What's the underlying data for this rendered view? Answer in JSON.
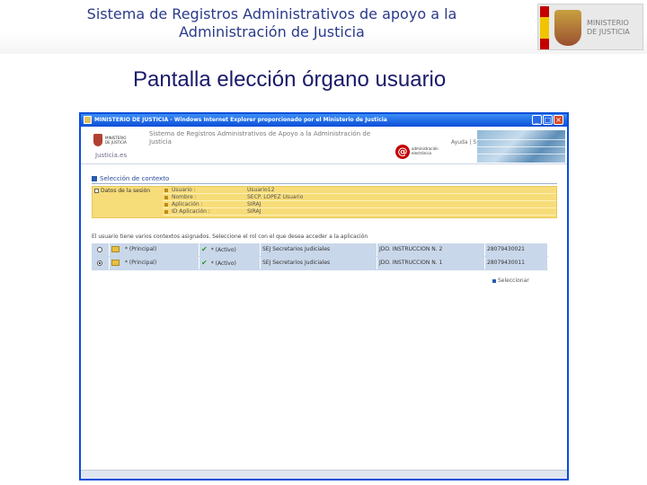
{
  "slide": {
    "header_title_line1": "Sistema de Registros Administrativos de apoyo a la",
    "header_title_line2": "Administración de Justicia",
    "logo_text_line1": "MINISTERIO",
    "logo_text_line2": "DE JUSTICIA",
    "subtitle": "Pantalla elección órgano usuario"
  },
  "browser": {
    "window_title": "MINISTERIO DE JUSTICIA - Windows Internet Explorer proporcionado por el Ministerio de Justicia",
    "controls": {
      "minimize": "_",
      "maximize": "□",
      "close": "×"
    }
  },
  "app": {
    "logo_text": "MINISTERIO DE JUSTICIA",
    "justicia_label": "Justicia.es",
    "system_title_line1": "Sistema de Registros Administrativos de Apoyo a la Administración de",
    "system_title_line2": "Justicia",
    "admin_logo_symbol": "@",
    "admin_logo_text": "administración electrónica",
    "help_link": "Ayuda | Salir"
  },
  "context": {
    "heading": "Selección de contexto",
    "session_label": "Datos de la sesión",
    "session_rows": [
      {
        "key": "Usuario :",
        "value": "Usuario12"
      },
      {
        "key": "Nombre :",
        "value": "SECP. LOPEZ Usuario"
      },
      {
        "key": "Aplicación :",
        "value": "SIRAJ"
      },
      {
        "key": "ID Aplicación :",
        "value": "SIRAJ"
      }
    ],
    "instructions": "El usuario tiene varios contextos asignados. Seleccione el rol con el que desea acceder a la aplicación",
    "rows": [
      {
        "selected": false,
        "role": "* (Principal)",
        "status": "* (Activo)",
        "code": "SEJ  Secretarios Judiciales",
        "organ": "JDO. INSTRUCCION N. 2",
        "number": "28079430021"
      },
      {
        "selected": true,
        "role": "* (Principal)",
        "status": "* (Activo)",
        "code": "SEJ  Secretarios Judiciales",
        "organ": "JDO. INSTRUCCION N. 1",
        "number": "28079430011"
      }
    ],
    "select_button": "Seleccionar"
  },
  "icons": [
    "window-icon",
    "folder-icon",
    "check-icon",
    "radio-icon"
  ],
  "colors": {
    "title_blue": "#2a3a8a",
    "subtitle_navy": "#1a1a6a",
    "xp_titlebar": "#0a4ed8",
    "session_yellow": "#f7dc7a",
    "table_blue": "#c9d7ea",
    "check_green": "#2a9a2a"
  }
}
